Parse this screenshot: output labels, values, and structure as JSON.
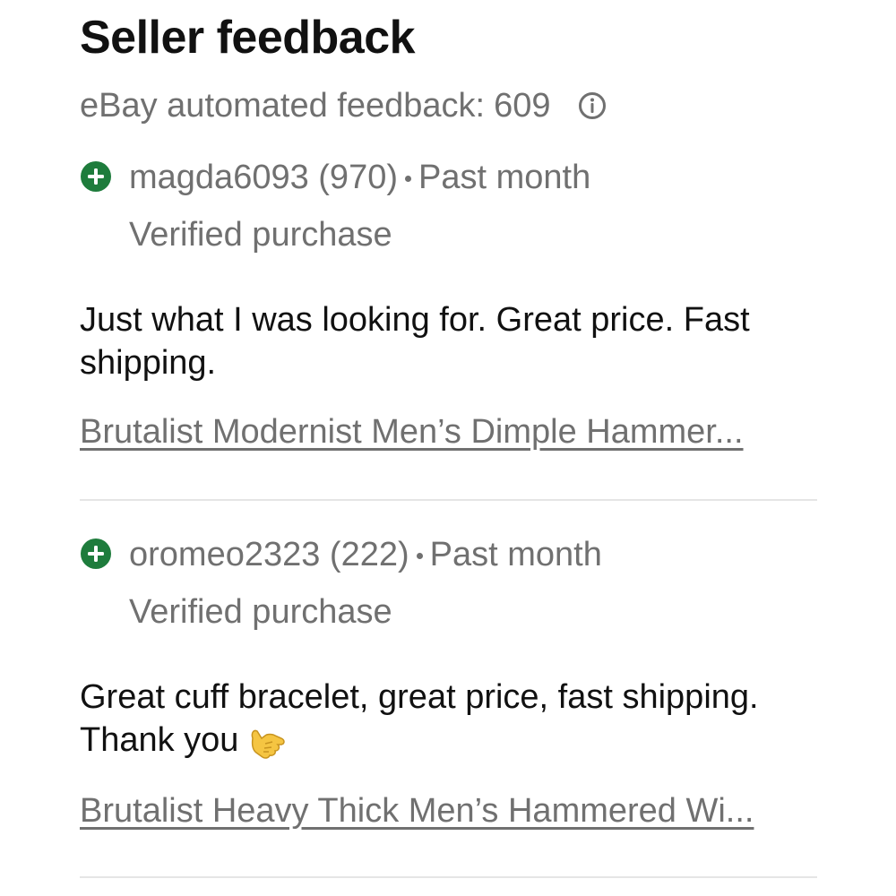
{
  "section": {
    "title": "Seller feedback",
    "automated_label": "eBay automated feedback:",
    "automated_count": "609",
    "info_icon": "info-circle-icon"
  },
  "reviews": [
    {
      "rating_icon": "positive-plus-icon",
      "rating_color": "#1e7c3c",
      "user": "magda6093 (970)",
      "time": "Past month",
      "verified": "Verified purchase",
      "comment": "Just what I was looking for. Great price. Fast shipping.",
      "item": "Brutalist Modernist Men’s Dimple Hammer..."
    },
    {
      "rating_icon": "positive-plus-icon",
      "rating_color": "#1e7c3c",
      "user": "oromeo2323 (222)",
      "time": "Past month",
      "verified": "Verified purchase",
      "comment": "Great cuff bracelet, great price, fast shipping. Thank you",
      "emoji": "call-me-hand-emoji",
      "item": "Brutalist Heavy Thick Men’s  Hammered Wi..."
    }
  ],
  "colors": {
    "text_primary": "#111111",
    "text_secondary": "#707070",
    "positive": "#1e7c3c",
    "divider": "#e5e5e5"
  }
}
